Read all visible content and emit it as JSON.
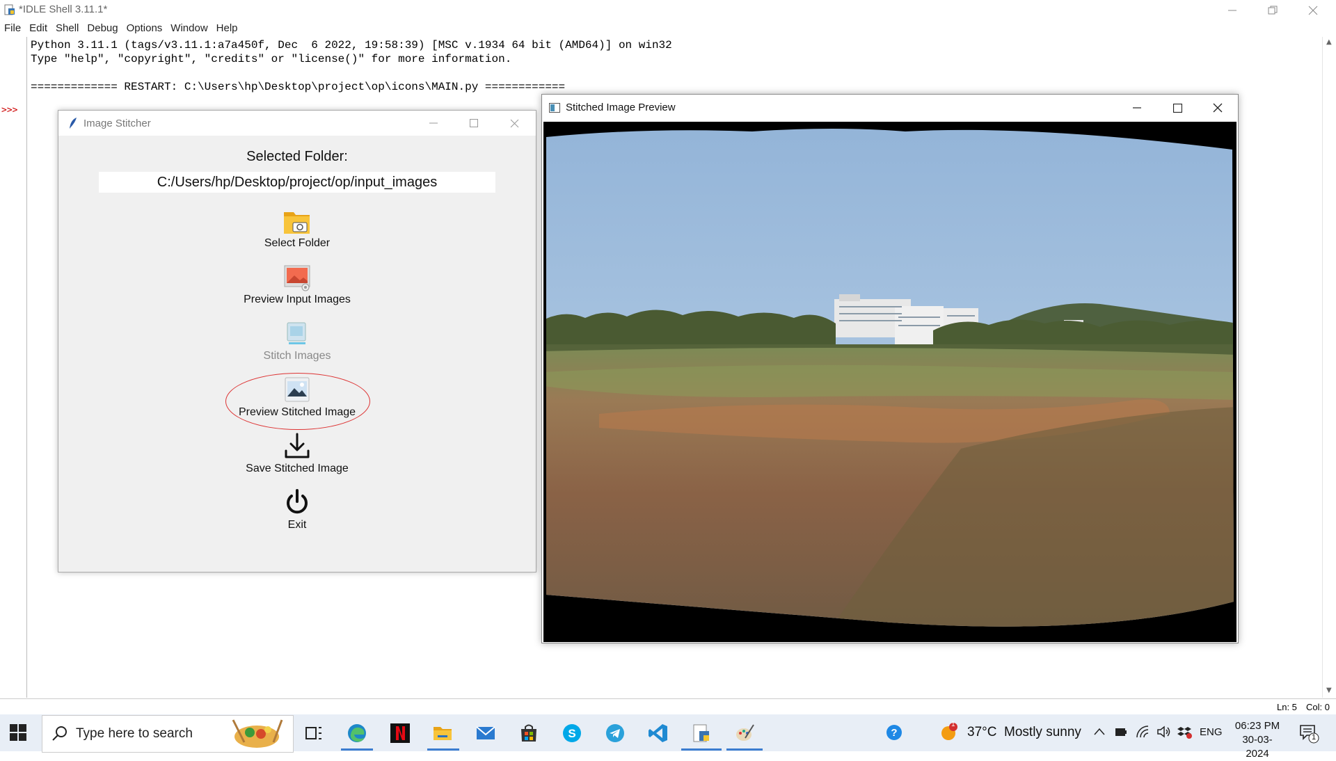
{
  "idle": {
    "title": "*IDLE Shell 3.11.1*",
    "menu": [
      "File",
      "Edit",
      "Shell",
      "Debug",
      "Options",
      "Window",
      "Help"
    ],
    "prompt": ">>>",
    "lines": [
      "Python 3.11.1 (tags/v3.11.1:a7a450f, Dec  6 2022, 19:58:39) [MSC v.1934 64 bit (AMD64)] on win32",
      "Type \"help\", \"copyright\", \"credits\" or \"license()\" for more information.",
      "",
      "============= RESTART: C:\\Users\\hp\\Desktop\\project\\op\\icons\\MAIN.py ============"
    ],
    "status": {
      "line": "Ln: 5",
      "col": "Col: 0"
    }
  },
  "stitcher": {
    "title": "Image Stitcher",
    "selected_label": "Selected Folder:",
    "folder_path": "C:/Users/hp/Desktop/project/op/input_images",
    "buttons": {
      "select_folder": "Select Folder",
      "preview_input": "Preview Input Images",
      "stitch": "Stitch Images",
      "preview_stitched": "Preview Stitched Image",
      "save": "Save Stitched Image",
      "exit": "Exit"
    }
  },
  "preview": {
    "title": "Stitched Image Preview"
  },
  "taskbar": {
    "search_placeholder": "Type here to search",
    "weather_temp": "37°C",
    "weather_text": "Mostly sunny",
    "weather_badge": "1",
    "lang": "ENG",
    "time": "06:23 PM",
    "date": "30-03-2024",
    "notif_count": "1"
  },
  "colors": {
    "accent": "#3b7cd0",
    "annotation": "#dd3333",
    "netflix": "#e50914"
  }
}
